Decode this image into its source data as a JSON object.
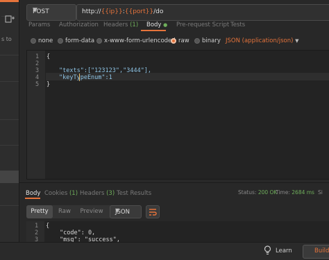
{
  "sidebar": {
    "fragment": "s to",
    "new_tab_icon": "plus-square-icon"
  },
  "request": {
    "method": "POST",
    "url_prefix": "http://",
    "url_var1": "{{ip}}",
    "url_sep": ":",
    "url_var2": "{{port}}",
    "url_suffix": "/do"
  },
  "tabs": [
    {
      "label": "Params"
    },
    {
      "label": "Authorization"
    },
    {
      "label": "Headers",
      "count": "(1)"
    },
    {
      "label": "Body",
      "active": true
    },
    {
      "label": "Pre-request Script"
    },
    {
      "label": "Tests"
    }
  ],
  "body_types": [
    {
      "label": "none",
      "checked": false
    },
    {
      "label": "form-data",
      "checked": false
    },
    {
      "label": "x-www-form-urlencoded",
      "checked": false
    },
    {
      "label": "raw",
      "checked": true
    },
    {
      "label": "binary",
      "checked": false
    }
  ],
  "content_type": "JSON (application/json)",
  "editor": {
    "line_numbers": [
      "1",
      "2",
      "3",
      "4",
      "5"
    ],
    "lines": [
      "{",
      "",
      "\"texts\":[\"123123\",\"3444\"],",
      "\"keyTypeEnum\":1",
      "}"
    ]
  },
  "response_tabs": [
    {
      "label": "Body",
      "active": true
    },
    {
      "label": "Cookies",
      "count": "(1)"
    },
    {
      "label": "Headers",
      "count": "(3)"
    },
    {
      "label": "Test Results"
    }
  ],
  "response_status": {
    "status_label": "Status:",
    "status_value": "200 OK",
    "time_label": "Time:",
    "time_value": "2684 ms",
    "size_label": "Si"
  },
  "view_modes": [
    "Pretty",
    "Raw",
    "Preview"
  ],
  "format": "JSON",
  "response": {
    "line_numbers": [
      "1",
      "2",
      "3"
    ],
    "lines": [
      "{",
      "\"code\": 0,",
      "\"msg\": \"success\","
    ]
  },
  "footer": {
    "learn": "Learn",
    "build": "Build"
  },
  "colors": {
    "accent": "#e5733b",
    "success": "#6fae5b"
  }
}
